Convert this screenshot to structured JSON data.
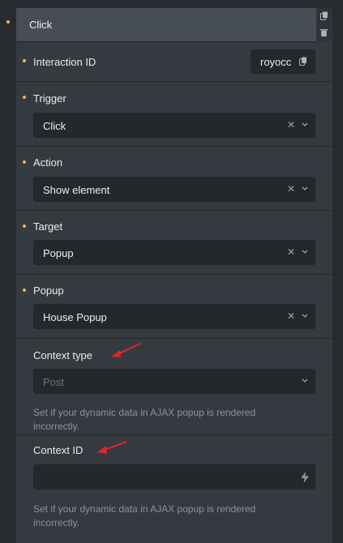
{
  "header": {
    "title": "Click",
    "copy_icon": "copy-icon",
    "delete_icon": "trash-icon"
  },
  "interaction_id": {
    "label": "Interaction ID",
    "value": "royocc",
    "icon": "copy-icon"
  },
  "trigger": {
    "label": "Trigger",
    "value": "Click"
  },
  "action": {
    "label": "Action",
    "value": "Show element"
  },
  "target": {
    "label": "Target",
    "value": "Popup"
  },
  "popup": {
    "label": "Popup",
    "value": "House Popup"
  },
  "context_type": {
    "label": "Context type",
    "placeholder": "Post",
    "help": "Set if your dynamic data in AJAX popup is rendered incorrectly."
  },
  "context_id": {
    "label": "Context ID",
    "value": "",
    "icon": "bolt-icon",
    "help": "Set if your dynamic data in AJAX popup is rendered incorrectly."
  },
  "colors": {
    "accent_dot": "#f5b83d",
    "annotation_arrow": "#e3262b"
  }
}
